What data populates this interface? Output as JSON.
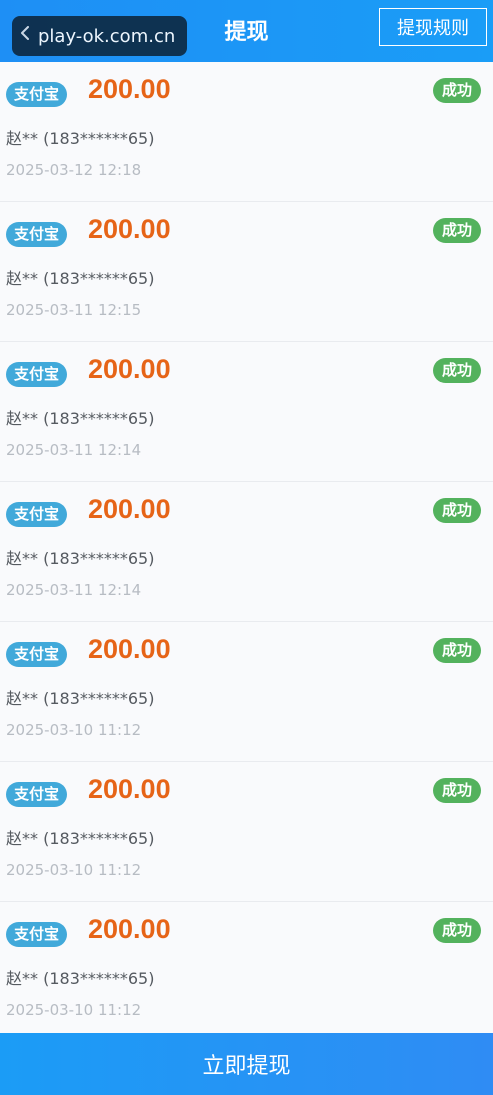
{
  "header": {
    "title": "提现",
    "watermark": "play-ok.com.cn",
    "rules_label": "提现规则"
  },
  "records": [
    {
      "method": "支付宝",
      "amount": "200.00",
      "account": "赵** (183******65)",
      "time": "2025-03-12 12:18",
      "status": "成功"
    },
    {
      "method": "支付宝",
      "amount": "200.00",
      "account": "赵** (183******65)",
      "time": "2025-03-11 12:15",
      "status": "成功"
    },
    {
      "method": "支付宝",
      "amount": "200.00",
      "account": "赵** (183******65)",
      "time": "2025-03-11 12:14",
      "status": "成功"
    },
    {
      "method": "支付宝",
      "amount": "200.00",
      "account": "赵** (183******65)",
      "time": "2025-03-11 12:14",
      "status": "成功"
    },
    {
      "method": "支付宝",
      "amount": "200.00",
      "account": "赵** (183******65)",
      "time": "2025-03-10 11:12",
      "status": "成功"
    },
    {
      "method": "支付宝",
      "amount": "200.00",
      "account": "赵** (183******65)",
      "time": "2025-03-10 11:12",
      "status": "成功"
    },
    {
      "method": "支付宝",
      "amount": "200.00",
      "account": "赵** (183******65)",
      "time": "2025-03-10 11:12",
      "status": "成功"
    }
  ],
  "footer": {
    "submit_label": "立即提现"
  },
  "colors": {
    "header": "#1e8ff5",
    "method_badge": "#41a9da",
    "amount": "#e66417",
    "status_success": "#53b25d"
  },
  "icons": {
    "back": "chevron-left-icon"
  }
}
